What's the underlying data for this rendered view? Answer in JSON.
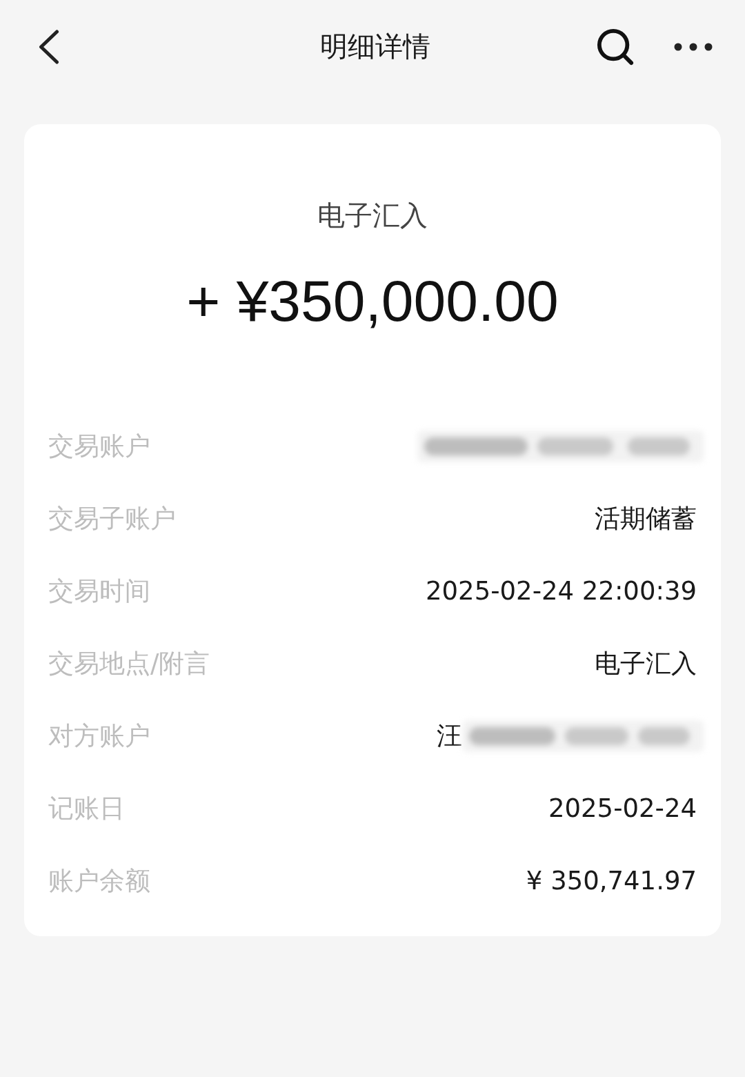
{
  "header": {
    "title": "明细详情"
  },
  "summary": {
    "type": "电子汇入",
    "amount": "+ ¥350,000.00"
  },
  "details": [
    {
      "label": "交易账户",
      "blurred": true
    },
    {
      "label": "交易子账户",
      "value": "活期储蓄",
      "blurred": false
    },
    {
      "label": "交易时间",
      "value": "2025-02-24 22:00:39",
      "blurred": false
    },
    {
      "label": "交易地点/附言",
      "value": "电子汇入",
      "blurred": false
    },
    {
      "label": "对方账户",
      "value": "汪",
      "blurred": true
    },
    {
      "label": "记账日",
      "value": "2025-02-24",
      "blurred": false
    },
    {
      "label": "账户余额",
      "value": "¥ 350,741.97",
      "blurred": false
    }
  ]
}
